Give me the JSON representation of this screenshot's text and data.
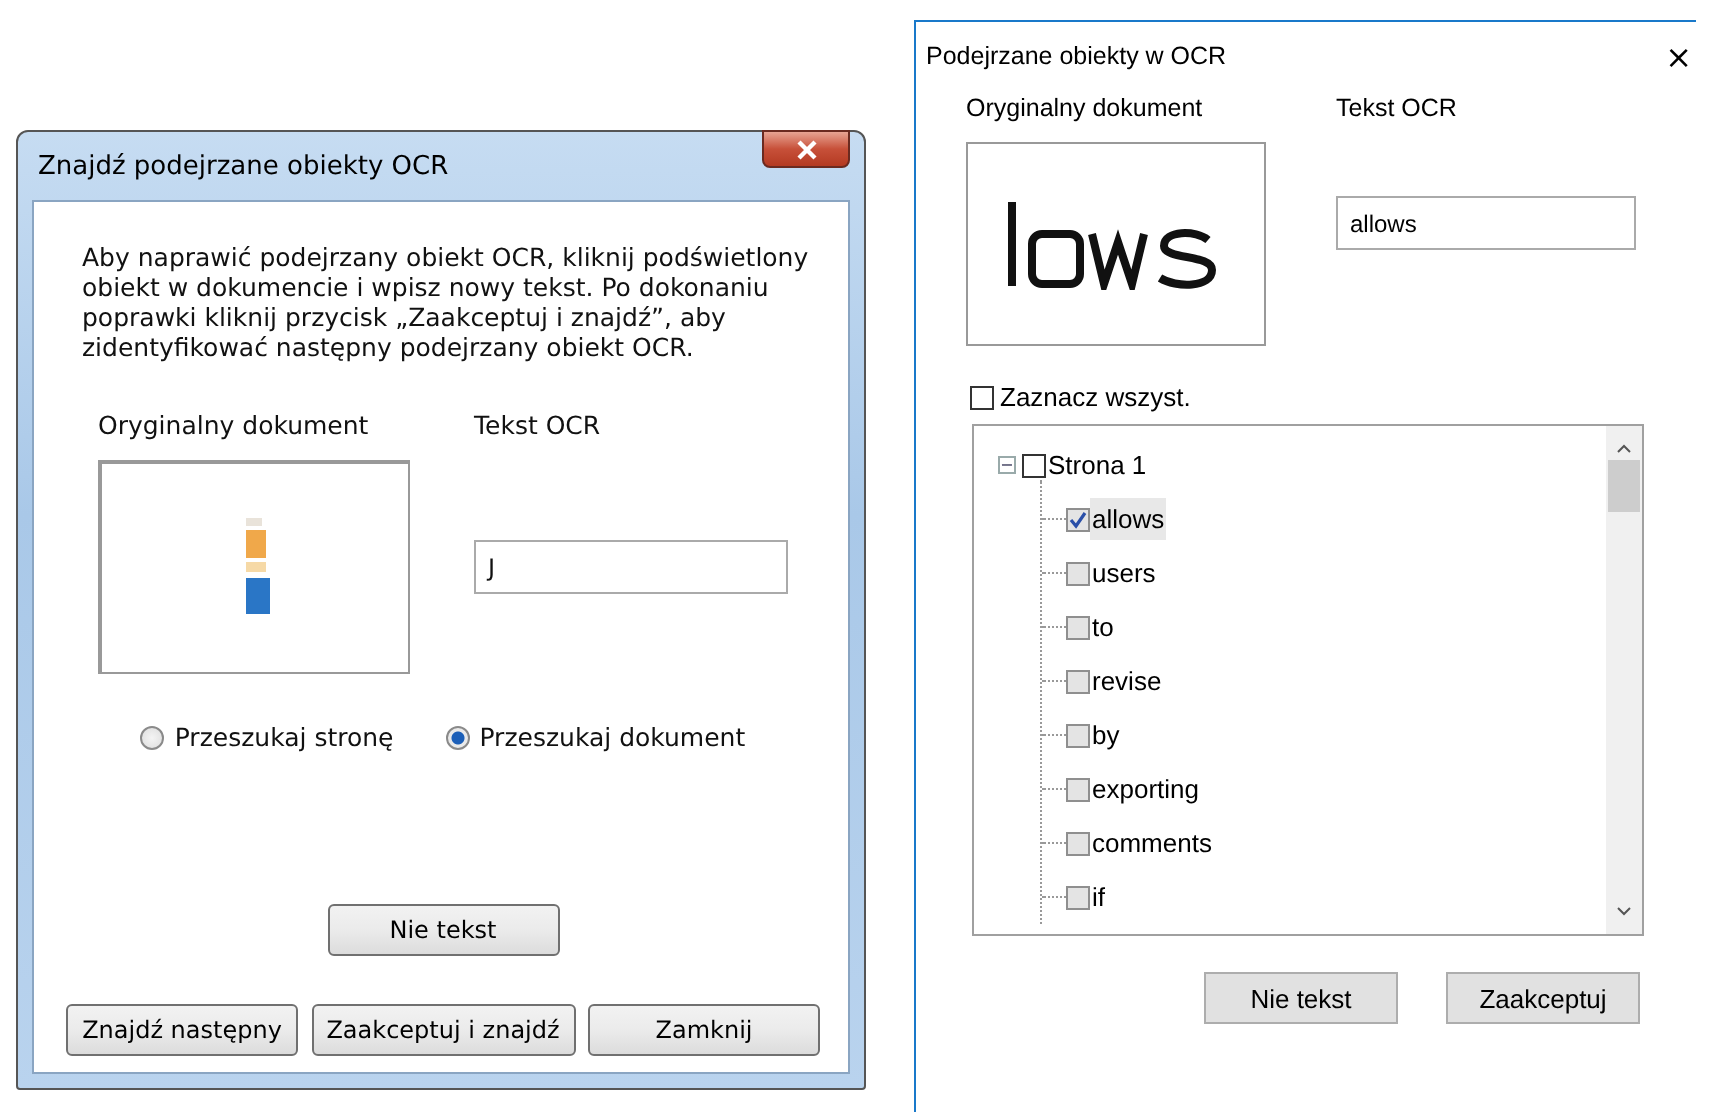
{
  "left_dialog": {
    "title": "Znajdź podejrzane obiekty OCR",
    "instructions": "Aby naprawić podejrzany obiekt OCR, kliknij podświetlony obiekt w dokumencie i wpisz nowy tekst. Po dokonaniu poprawki kliknij przycisk „Zaakceptuj i znajdź”, aby zidentyfikować następny podejrzany obiekt OCR.",
    "original_label": "Oryginalny dokument",
    "ocr_label": "Tekst OCR",
    "ocr_value": "J",
    "search_scope": [
      {
        "label": "Przeszukaj stronę",
        "selected": false
      },
      {
        "label": "Przeszukaj dokument",
        "selected": true
      }
    ],
    "not_text_button": "Nie tekst",
    "buttons": [
      "Znajdź następny",
      "Zaakceptuj i znajdź",
      "Zamknij"
    ]
  },
  "right_dialog": {
    "title": "Podejrzane obiekty w OCR",
    "close": "×",
    "original_label": "Oryginalny dokument",
    "ocr_label": "Tekst OCR",
    "ocr_value": "allows",
    "select_all": {
      "label": "Zaznacz wszyst.",
      "checked": false
    },
    "tree": [
      {
        "label": "Strona 1",
        "checked": false,
        "expanded": true,
        "expander": "−",
        "children": [
          {
            "label": "allows",
            "checked": true,
            "selected": true
          },
          {
            "label": "users",
            "checked": false,
            "selected": false
          },
          {
            "label": "to",
            "checked": false,
            "selected": false
          },
          {
            "label": "revise",
            "checked": false,
            "selected": false
          },
          {
            "label": "by",
            "checked": false,
            "selected": false
          },
          {
            "label": "exporting",
            "checked": false,
            "selected": false
          },
          {
            "label": "comments",
            "checked": false,
            "selected": false
          },
          {
            "label": "if",
            "checked": false,
            "selected": false
          }
        ]
      }
    ],
    "buttons": [
      "Nie tekst",
      "Zaakceptuj"
    ]
  }
}
